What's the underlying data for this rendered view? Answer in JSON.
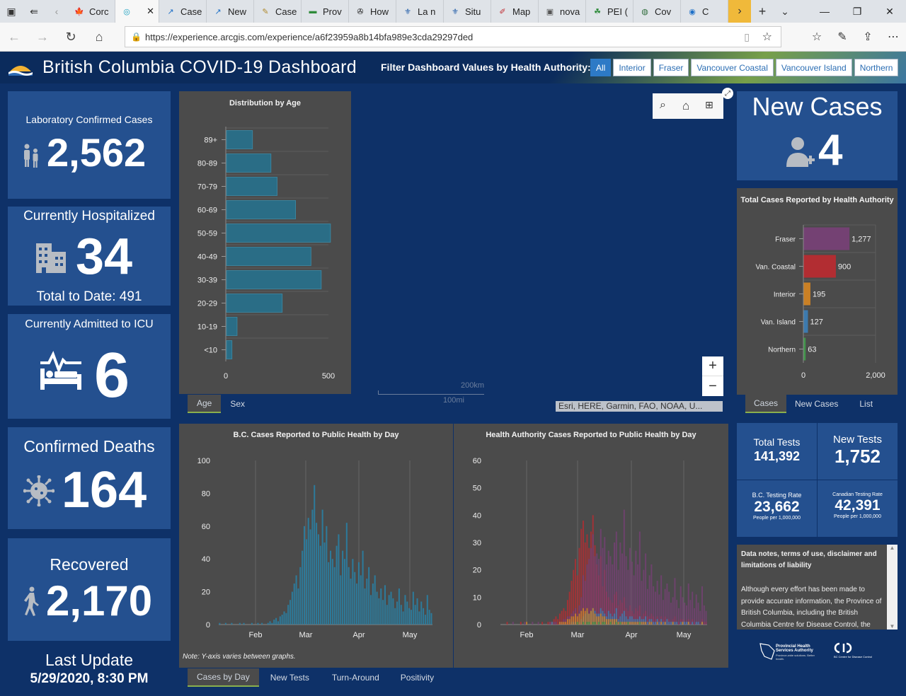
{
  "browser": {
    "tabs": [
      {
        "label": "Corc",
        "fav": "🍁",
        "favColor": "#d52b1e"
      },
      {
        "label": "",
        "fav": "◎",
        "favColor": "#1aa0c0",
        "active": true
      },
      {
        "label": "Case",
        "fav": "↗",
        "favColor": "#1e70c8"
      },
      {
        "label": "New",
        "fav": "↗",
        "favColor": "#1e70c8"
      },
      {
        "label": "Case",
        "fav": "✎",
        "favColor": "#b0892c"
      },
      {
        "label": "Prov",
        "fav": "▬",
        "favColor": "#2e8b3a"
      },
      {
        "label": "How",
        "fav": "✇",
        "favColor": "#111"
      },
      {
        "label": "La n",
        "fav": "⚜",
        "favColor": "#1e5aa8"
      },
      {
        "label": "Situ",
        "fav": "⚜",
        "favColor": "#1e5aa8"
      },
      {
        "label": "Map",
        "fav": "✐",
        "favColor": "#c0282e"
      },
      {
        "label": "nova",
        "fav": "▣",
        "favColor": "#555"
      },
      {
        "label": "PEI (",
        "fav": "☘",
        "favColor": "#2e8b3a"
      },
      {
        "label": "Cov",
        "fav": "◍",
        "favColor": "#2e6b3a"
      },
      {
        "label": "C",
        "fav": "◉",
        "favColor": "#1e70c8"
      }
    ],
    "url": "https://experience.arcgis.com/experience/a6f23959a8b14bfa989e3cda29297ded"
  },
  "header": {
    "title": "British Columbia COVID-19 Dashboard",
    "filter_label": "Filter Dashboard Values by Health Authority:",
    "filters": [
      "All",
      "Interior",
      "Fraser",
      "Vancouver Coastal",
      "Vancouver Island",
      "Northern"
    ]
  },
  "kpis": {
    "lab_confirmed": {
      "label": "Laboratory Confirmed Cases",
      "value": "2,562"
    },
    "hospitalized": {
      "label": "Currently Hospitalized",
      "value": "34",
      "sub": "Total to Date: 491"
    },
    "icu": {
      "label": "Currently Admitted to ICU",
      "value": "6"
    },
    "deaths": {
      "label": "Confirmed Deaths",
      "value": "164"
    },
    "recovered": {
      "label": "Recovered",
      "value": "2,170"
    },
    "last_update": {
      "label": "Last Update",
      "value": "5/29/2020, 8:30 PM"
    }
  },
  "age_chart": {
    "title": "Distribution by Age",
    "tabs": [
      "Age",
      "Sex"
    ]
  },
  "map": {
    "scale_km": "200km",
    "scale_mi": "100mi",
    "attribution": "Esri, HERE, Garmin, FAO, NOAA, U..."
  },
  "new_cases": {
    "label": "New Cases",
    "value": "4"
  },
  "ha_chart": {
    "title": "Total Cases Reported by Health Authority",
    "tabs": [
      "Cases",
      "New Cases",
      "List"
    ]
  },
  "daily_bc": {
    "title": "B.C. Cases Reported to Public Health by Day",
    "note": "Note: Y-axis varies between graphs."
  },
  "daily_ha": {
    "title": "Health Authority Cases Reported to Public Health by Day"
  },
  "bottom_tabs": [
    "Cases by Day",
    "New Tests",
    "Turn-Around",
    "Positivity"
  ],
  "tests": {
    "total_label": "Total Tests",
    "total_value": "141,392",
    "new_label": "New Tests",
    "new_value": "1,752",
    "bc_rate_label": "B.C. Testing Rate",
    "bc_rate_value": "23,662",
    "bc_rate_sub": "People per 1,000,000",
    "ca_rate_label": "Canadian Testing Rate",
    "ca_rate_value": "42,391",
    "ca_rate_sub": "People per 1,000,000"
  },
  "notes": {
    "title": "Data notes, terms of use, disclaimer and limitations of liability",
    "body": "Although every effort has been made to provide accurate information, the Province of British Columbia, including the British Columbia Centre for Disease Control, the"
  },
  "logos": {
    "phsa": "Provincial Health Services Authority",
    "phsa_sub": "Province-wide solutions. Better health.",
    "bccdc": "BC Centre for Disease Control"
  },
  "colors": {
    "fraser": "#7b3f7a",
    "vancoastal": "#c4282e",
    "interior": "#e08a1e",
    "vanisland": "#3b83c0",
    "northern": "#3fa24a",
    "teal": "#2a6d86",
    "accent": "#8ab04d"
  },
  "chart_data": [
    {
      "type": "bar",
      "title": "Distribution by Age",
      "orientation": "horizontal",
      "categories": [
        "89+",
        "80-89",
        "70-79",
        "60-69",
        "50-59",
        "40-49",
        "30-39",
        "20-29",
        "10-19",
        "<10"
      ],
      "values": [
        130,
        220,
        250,
        340,
        510,
        415,
        465,
        275,
        55,
        30
      ],
      "xlim": [
        0,
        500
      ],
      "xticks": [
        0,
        500
      ]
    },
    {
      "type": "bar",
      "title": "Total Cases Reported by Health Authority",
      "orientation": "horizontal",
      "categories": [
        "Fraser",
        "Van. Coastal",
        "Interior",
        "Van. Island",
        "Northern"
      ],
      "values": [
        1277,
        900,
        195,
        127,
        63
      ],
      "value_labels": [
        "1,277",
        "900",
        "195",
        "127",
        "63"
      ],
      "colors": [
        "#7b3f7a",
        "#c4282e",
        "#e08a1e",
        "#3b83c0",
        "#3fa24a"
      ],
      "xlim": [
        0,
        2000
      ],
      "xticks": [
        "0",
        "2,000"
      ]
    },
    {
      "type": "bar",
      "title": "B.C. Cases Reported to Public Health by Day",
      "x_ticks": [
        "Feb",
        "Mar",
        "Apr",
        "May"
      ],
      "ylim": [
        0,
        100
      ],
      "yticks": [
        0,
        20,
        40,
        60,
        80,
        100
      ],
      "values": [
        1,
        0,
        0,
        1,
        0,
        0,
        1,
        0,
        0,
        0,
        1,
        0,
        1,
        0,
        0,
        0,
        1,
        0,
        0,
        1,
        0,
        1,
        0,
        0,
        1,
        2,
        1,
        3,
        4,
        2,
        5,
        6,
        8,
        7,
        12,
        15,
        20,
        25,
        30,
        22,
        35,
        45,
        60,
        52,
        65,
        58,
        70,
        85,
        62,
        55,
        48,
        70,
        50,
        60,
        38,
        45,
        40,
        35,
        48,
        55,
        30,
        45,
        40,
        62,
        35,
        28,
        40,
        32,
        25,
        38,
        30,
        45,
        22,
        28,
        35,
        18,
        25,
        30,
        20,
        16,
        22,
        15,
        24,
        12,
        18,
        20,
        16,
        10,
        14,
        22,
        12,
        8,
        18,
        14,
        10,
        9,
        20,
        12,
        16,
        8,
        14,
        10,
        6,
        18,
        9,
        7
      ]
    },
    {
      "type": "bar",
      "title": "Health Authority Cases Reported to Public Health by Day",
      "x_ticks": [
        "Feb",
        "Mar",
        "Apr",
        "May"
      ],
      "ylim": [
        0,
        60
      ],
      "yticks": [
        0,
        10,
        20,
        30,
        40,
        50,
        60
      ],
      "series": [
        {
          "name": "",
          "color": "#c4282e",
          "values": [
            0,
            0,
            0,
            1,
            0,
            0,
            0,
            0,
            0,
            0,
            1,
            0,
            0,
            0,
            0,
            0,
            0,
            0,
            0,
            0,
            0,
            1,
            0,
            0,
            1,
            1,
            1,
            2,
            3,
            2,
            4,
            5,
            6,
            5,
            9,
            12,
            16,
            20,
            24,
            18,
            28,
            35,
            38,
            30,
            33,
            28,
            34,
            40,
            29,
            22,
            18,
            25,
            14,
            20,
            12,
            10,
            9,
            8,
            11,
            12,
            7,
            9,
            8,
            10,
            6,
            5,
            7,
            5,
            4,
            6,
            5,
            7,
            3,
            4,
            5,
            3,
            3,
            4,
            3,
            2,
            3,
            2,
            3,
            2,
            3,
            2,
            2,
            1,
            2,
            3,
            1,
            1,
            2,
            2,
            1,
            1,
            2,
            1,
            2,
            1,
            1,
            1,
            0,
            2,
            1,
            1
          ]
        },
        {
          "name": "",
          "color": "#7b3f7a",
          "values": [
            0,
            0,
            0,
            0,
            0,
            0,
            1,
            0,
            0,
            0,
            0,
            0,
            1,
            0,
            0,
            0,
            1,
            0,
            0,
            1,
            0,
            0,
            0,
            0,
            0,
            1,
            0,
            1,
            1,
            0,
            1,
            1,
            2,
            2,
            3,
            3,
            4,
            5,
            6,
            4,
            7,
            10,
            18,
            16,
            22,
            24,
            28,
            33,
            25,
            26,
            24,
            35,
            28,
            32,
            22,
            27,
            25,
            22,
            30,
            34,
            20,
            30,
            26,
            42,
            25,
            20,
            28,
            23,
            18,
            27,
            22,
            34,
            16,
            20,
            26,
            13,
            18,
            22,
            14,
            12,
            16,
            11,
            18,
            9,
            13,
            15,
            12,
            8,
            10,
            17,
            9,
            6,
            14,
            10,
            8,
            7,
            15,
            9,
            12,
            6,
            11,
            8,
            5,
            14,
            7,
            5
          ]
        },
        {
          "name": "",
          "color": "#3b83c0",
          "values": [
            0,
            0,
            0,
            0,
            0,
            0,
            0,
            0,
            0,
            0,
            0,
            0,
            0,
            0,
            0,
            0,
            0,
            0,
            0,
            0,
            0,
            0,
            0,
            0,
            0,
            0,
            1,
            0,
            0,
            0,
            0,
            0,
            0,
            0,
            0,
            0,
            1,
            1,
            1,
            0,
            1,
            2,
            3,
            4,
            5,
            4,
            5,
            6,
            5,
            4,
            4,
            6,
            5,
            4,
            3,
            5,
            4,
            3,
            4,
            6,
            2,
            3,
            4,
            5,
            3,
            2,
            3,
            3,
            2,
            2,
            2,
            3,
            2,
            2,
            3,
            1,
            2,
            2,
            1,
            1,
            2,
            1,
            2,
            1,
            1,
            2,
            1,
            1,
            1,
            1,
            1,
            0,
            1,
            1,
            1,
            1,
            1,
            0,
            1,
            0,
            1,
            1,
            0,
            1,
            0,
            0
          ]
        },
        {
          "name": "",
          "color": "#e08a1e",
          "values": [
            0,
            0,
            0,
            0,
            0,
            0,
            0,
            0,
            0,
            0,
            0,
            0,
            0,
            1,
            0,
            0,
            0,
            0,
            0,
            0,
            0,
            0,
            0,
            0,
            0,
            0,
            0,
            0,
            0,
            0,
            1,
            1,
            1,
            1,
            2,
            2,
            3,
            3,
            4,
            3,
            4,
            5,
            6,
            5,
            6,
            4,
            5,
            6,
            4,
            3,
            3,
            4,
            3,
            3,
            2,
            2,
            2,
            2,
            2,
            2,
            1,
            1,
            1,
            1,
            1,
            1,
            1,
            1,
            1,
            1,
            1,
            1,
            1,
            1,
            1,
            0,
            1,
            1,
            0,
            0,
            1,
            0,
            1,
            0,
            1,
            0,
            0,
            0,
            1,
            0,
            0,
            0,
            0,
            1,
            0,
            0,
            1,
            0,
            0,
            0,
            0,
            0,
            0,
            1,
            0,
            0
          ]
        },
        {
          "name": "",
          "color": "#3fa24a",
          "values": [
            0,
            0,
            0,
            0,
            0,
            0,
            0,
            0,
            0,
            0,
            0,
            0,
            0,
            0,
            0,
            0,
            0,
            0,
            0,
            0,
            0,
            0,
            0,
            0,
            0,
            0,
            0,
            0,
            0,
            0,
            0,
            0,
            0,
            0,
            0,
            0,
            0,
            0,
            0,
            1,
            0,
            0,
            1,
            0,
            1,
            1,
            0,
            1,
            1,
            0,
            1,
            0,
            1,
            1,
            0,
            0,
            1,
            0,
            0,
            1,
            0,
            1,
            0,
            0,
            0,
            1,
            0,
            0,
            0,
            0,
            0,
            1,
            0,
            0,
            0,
            0,
            0,
            0,
            0,
            0,
            0,
            0,
            0,
            0,
            0,
            0,
            0,
            0,
            0,
            0,
            0,
            0,
            0,
            0,
            0,
            0,
            0,
            0,
            0,
            0,
            0,
            0,
            0,
            0,
            0,
            0
          ]
        }
      ]
    }
  ]
}
